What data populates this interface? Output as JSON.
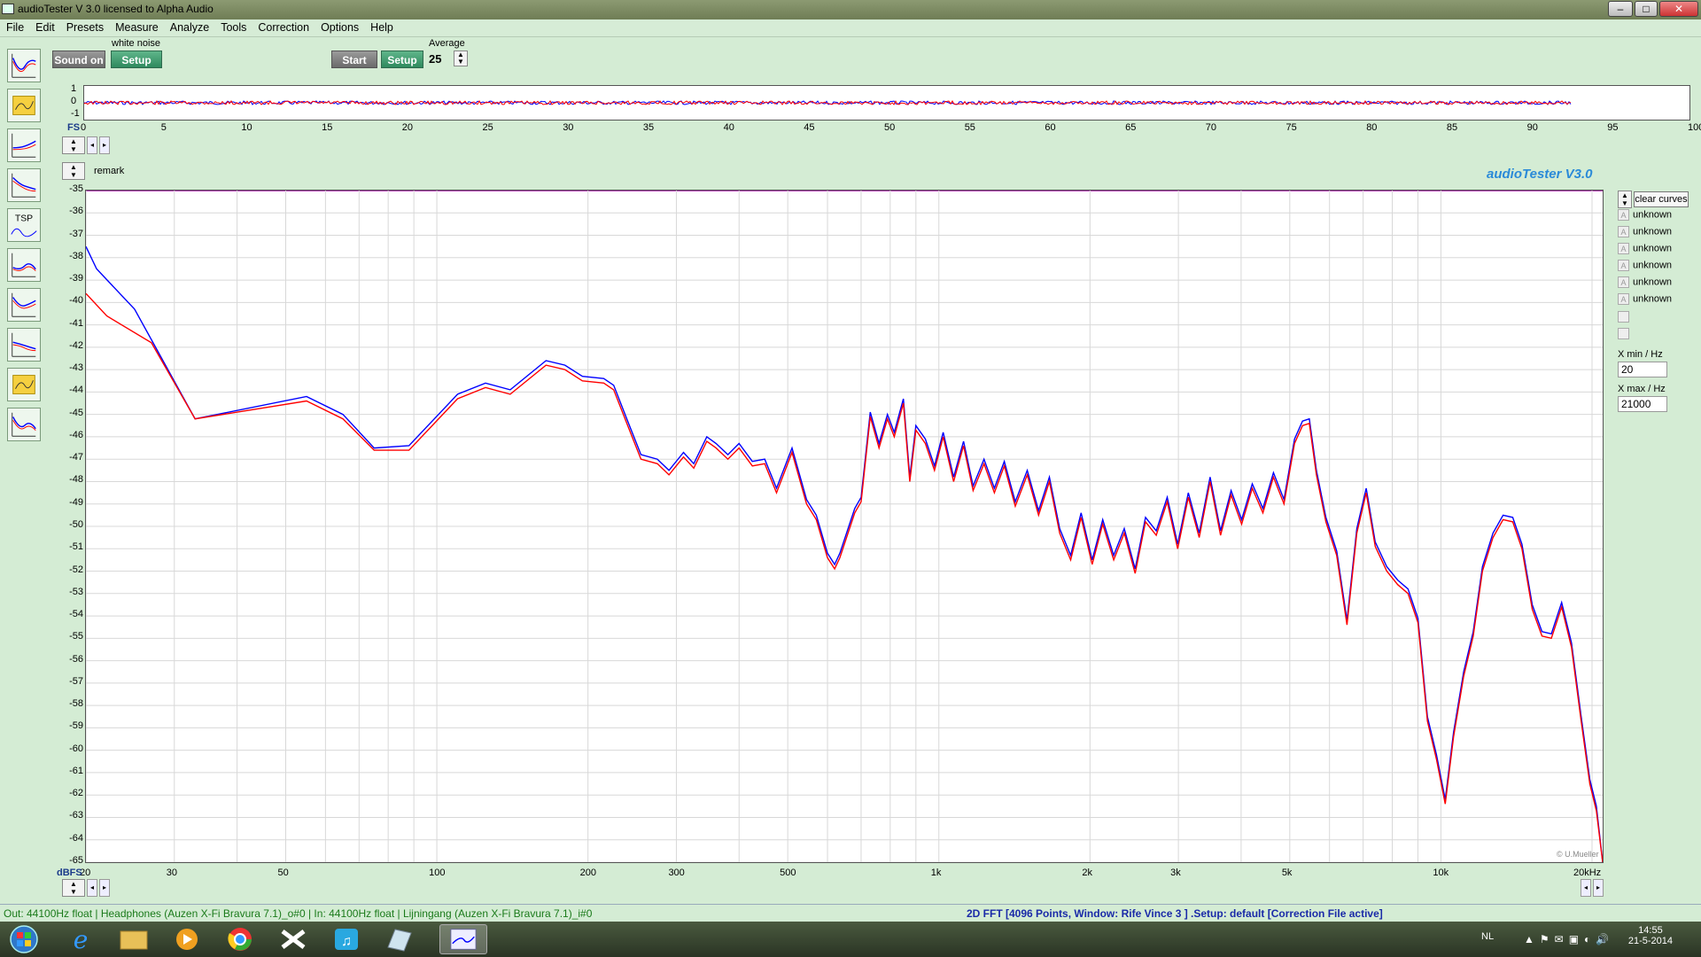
{
  "window": {
    "title": "audioTester  V 3.0   licensed to Alpha Audio"
  },
  "menu": [
    "File",
    "Edit",
    "Presets",
    "Measure",
    "Analyze",
    "Tools",
    "Correction",
    "Options",
    "Help"
  ],
  "toolbar": {
    "generator_label": "white noise",
    "sound_on": "Sound on",
    "setup1": "Setup",
    "start": "Start",
    "setup2": "Setup",
    "average_label": "Average",
    "average_value": "25"
  },
  "time_plot": {
    "y_ticks": [
      "1",
      "0",
      "-1"
    ],
    "x_prefix": "FS",
    "x_ticks": [
      "0",
      "5",
      "10",
      "15",
      "20",
      "25",
      "30",
      "35",
      "40",
      "45",
      "50",
      "55",
      "60",
      "65",
      "70",
      "75",
      "80",
      "85",
      "90",
      "95",
      "100ms"
    ]
  },
  "main": {
    "remark": "remark",
    "brand": "audioTester  V3.0",
    "copyright": "© U.Mueller",
    "y_unit": "dBFS",
    "y_ticks": [
      "-35",
      "-36",
      "-37",
      "-38",
      "-39",
      "-40",
      "-41",
      "-42",
      "-43",
      "-44",
      "-45",
      "-46",
      "-47",
      "-48",
      "-49",
      "-50",
      "-51",
      "-52",
      "-53",
      "-54",
      "-55",
      "-56",
      "-57",
      "-58",
      "-59",
      "-60",
      "-61",
      "-62",
      "-63",
      "-64",
      "-65"
    ],
    "x_ticks": [
      {
        "label": "20",
        "f": 20
      },
      {
        "label": "30",
        "f": 30
      },
      {
        "label": "50",
        "f": 50
      },
      {
        "label": "100",
        "f": 100
      },
      {
        "label": "200",
        "f": 200
      },
      {
        "label": "300",
        "f": 300
      },
      {
        "label": "500",
        "f": 500
      },
      {
        "label": "1k",
        "f": 1000
      },
      {
        "label": "2k",
        "f": 2000
      },
      {
        "label": "3k",
        "f": 3000
      },
      {
        "label": "5k",
        "f": 5000
      },
      {
        "label": "10k",
        "f": 10000
      },
      {
        "label": "20kHz",
        "f": 20000
      }
    ]
  },
  "chart_data": {
    "type": "line",
    "title": "",
    "xlabel": "",
    "ylabel": "dBFS",
    "xscale": "log",
    "xlim": [
      20,
      21000
    ],
    "ylim": [
      -65,
      -35
    ],
    "grid": true,
    "series": [
      {
        "color": "#0000ff",
        "points": [
          [
            20,
            -37.5
          ],
          [
            21,
            -38.5
          ],
          [
            25,
            -40.3
          ],
          [
            33,
            -45.2
          ],
          [
            55,
            -44.2
          ],
          [
            65,
            -45
          ],
          [
            75,
            -46.5
          ],
          [
            88,
            -46.4
          ],
          [
            110,
            -44.1
          ],
          [
            125,
            -43.6
          ],
          [
            140,
            -43.9
          ],
          [
            165,
            -42.6
          ],
          [
            180,
            -42.8
          ],
          [
            195,
            -43.3
          ],
          [
            215,
            -43.4
          ],
          [
            225,
            -43.7
          ],
          [
            240,
            -45.3
          ],
          [
            255,
            -46.8
          ],
          [
            275,
            -47
          ],
          [
            290,
            -47.5
          ],
          [
            310,
            -46.7
          ],
          [
            325,
            -47.2
          ],
          [
            345,
            -46
          ],
          [
            360,
            -46.3
          ],
          [
            380,
            -46.8
          ],
          [
            400,
            -46.3
          ],
          [
            425,
            -47.1
          ],
          [
            450,
            -47
          ],
          [
            475,
            -48.3
          ],
          [
            510,
            -46.5
          ],
          [
            545,
            -48.8
          ],
          [
            570,
            -49.5
          ],
          [
            600,
            -51.2
          ],
          [
            620,
            -51.7
          ],
          [
            635,
            -51.2
          ],
          [
            680,
            -49.2
          ],
          [
            700,
            -48.7
          ],
          [
            730,
            -44.9
          ],
          [
            760,
            -46.3
          ],
          [
            790,
            -45
          ],
          [
            815,
            -45.8
          ],
          [
            850,
            -44.3
          ],
          [
            875,
            -47.8
          ],
          [
            900,
            -45.5
          ],
          [
            940,
            -46.1
          ],
          [
            980,
            -47.3
          ],
          [
            1020,
            -45.8
          ],
          [
            1070,
            -47.8
          ],
          [
            1120,
            -46.2
          ],
          [
            1170,
            -48.2
          ],
          [
            1230,
            -47
          ],
          [
            1290,
            -48.3
          ],
          [
            1350,
            -47.1
          ],
          [
            1420,
            -48.9
          ],
          [
            1500,
            -47.5
          ],
          [
            1580,
            -49.3
          ],
          [
            1660,
            -47.8
          ],
          [
            1740,
            -50.1
          ],
          [
            1830,
            -51.3
          ],
          [
            1920,
            -49.4
          ],
          [
            2020,
            -51.5
          ],
          [
            2120,
            -49.7
          ],
          [
            2230,
            -51.3
          ],
          [
            2340,
            -50.1
          ],
          [
            2460,
            -51.9
          ],
          [
            2580,
            -49.6
          ],
          [
            2710,
            -50.2
          ],
          [
            2850,
            -48.7
          ],
          [
            2990,
            -50.8
          ],
          [
            3140,
            -48.5
          ],
          [
            3300,
            -50.3
          ],
          [
            3470,
            -47.8
          ],
          [
            3640,
            -50.2
          ],
          [
            3820,
            -48.4
          ],
          [
            4010,
            -49.7
          ],
          [
            4210,
            -48.1
          ],
          [
            4420,
            -49.2
          ],
          [
            4640,
            -47.6
          ],
          [
            4870,
            -48.8
          ],
          [
            5110,
            -46.1
          ],
          [
            5300,
            -45.3
          ],
          [
            5470,
            -45.2
          ],
          [
            5650,
            -47.5
          ],
          [
            5900,
            -49.6
          ],
          [
            6200,
            -51.1
          ],
          [
            6500,
            -54.2
          ],
          [
            6800,
            -50.1
          ],
          [
            7100,
            -48.3
          ],
          [
            7400,
            -50.7
          ],
          [
            7800,
            -51.8
          ],
          [
            8200,
            -52.4
          ],
          [
            8600,
            -52.8
          ],
          [
            9000,
            -54.1
          ],
          [
            9400,
            -58.5
          ],
          [
            9800,
            -60.2
          ],
          [
            10200,
            -62.2
          ],
          [
            10600,
            -59.2
          ],
          [
            11100,
            -56.5
          ],
          [
            11600,
            -54.7
          ],
          [
            12100,
            -51.8
          ],
          [
            12700,
            -50.3
          ],
          [
            13300,
            -49.5
          ],
          [
            13900,
            -49.6
          ],
          [
            14500,
            -50.8
          ],
          [
            15200,
            -53.5
          ],
          [
            15900,
            -54.7
          ],
          [
            16600,
            -54.8
          ],
          [
            17400,
            -53.4
          ],
          [
            18200,
            -55.2
          ],
          [
            19000,
            -58.4
          ],
          [
            19800,
            -61.3
          ],
          [
            20400,
            -62.5
          ],
          [
            21000,
            -65
          ]
        ]
      },
      {
        "color": "#ff0000",
        "points": [
          [
            20,
            -39.6
          ],
          [
            22,
            -40.6
          ],
          [
            27,
            -41.8
          ],
          [
            33,
            -45.2
          ],
          [
            55,
            -44.4
          ],
          [
            65,
            -45.2
          ],
          [
            75,
            -46.6
          ],
          [
            88,
            -46.6
          ],
          [
            110,
            -44.3
          ],
          [
            125,
            -43.8
          ],
          [
            140,
            -44.1
          ],
          [
            165,
            -42.8
          ],
          [
            180,
            -43
          ],
          [
            195,
            -43.5
          ],
          [
            215,
            -43.6
          ],
          [
            225,
            -43.9
          ],
          [
            240,
            -45.5
          ],
          [
            255,
            -47
          ],
          [
            275,
            -47.2
          ],
          [
            290,
            -47.7
          ],
          [
            310,
            -46.9
          ],
          [
            325,
            -47.4
          ],
          [
            345,
            -46.2
          ],
          [
            360,
            -46.5
          ],
          [
            380,
            -47
          ],
          [
            400,
            -46.5
          ],
          [
            425,
            -47.3
          ],
          [
            450,
            -47.2
          ],
          [
            475,
            -48.5
          ],
          [
            510,
            -46.7
          ],
          [
            545,
            -49
          ],
          [
            570,
            -49.7
          ],
          [
            600,
            -51.4
          ],
          [
            620,
            -51.9
          ],
          [
            635,
            -51.4
          ],
          [
            680,
            -49.4
          ],
          [
            700,
            -48.9
          ],
          [
            730,
            -45.1
          ],
          [
            760,
            -46.5
          ],
          [
            790,
            -45.2
          ],
          [
            815,
            -46
          ],
          [
            850,
            -44.5
          ],
          [
            875,
            -48
          ],
          [
            900,
            -45.7
          ],
          [
            940,
            -46.3
          ],
          [
            980,
            -47.5
          ],
          [
            1020,
            -46
          ],
          [
            1070,
            -48
          ],
          [
            1120,
            -46.4
          ],
          [
            1170,
            -48.4
          ],
          [
            1230,
            -47.2
          ],
          [
            1290,
            -48.5
          ],
          [
            1350,
            -47.3
          ],
          [
            1420,
            -49.1
          ],
          [
            1500,
            -47.7
          ],
          [
            1580,
            -49.5
          ],
          [
            1660,
            -48
          ],
          [
            1740,
            -50.3
          ],
          [
            1830,
            -51.5
          ],
          [
            1920,
            -49.6
          ],
          [
            2020,
            -51.7
          ],
          [
            2120,
            -49.9
          ],
          [
            2230,
            -51.5
          ],
          [
            2340,
            -50.3
          ],
          [
            2460,
            -52.1
          ],
          [
            2580,
            -49.8
          ],
          [
            2710,
            -50.4
          ],
          [
            2850,
            -48.9
          ],
          [
            2990,
            -51
          ],
          [
            3140,
            -48.7
          ],
          [
            3300,
            -50.5
          ],
          [
            3470,
            -48
          ],
          [
            3640,
            -50.4
          ],
          [
            3820,
            -48.6
          ],
          [
            4010,
            -49.9
          ],
          [
            4210,
            -48.3
          ],
          [
            4420,
            -49.4
          ],
          [
            4640,
            -47.8
          ],
          [
            4870,
            -49
          ],
          [
            5110,
            -46.3
          ],
          [
            5300,
            -45.5
          ],
          [
            5470,
            -45.4
          ],
          [
            5650,
            -47.7
          ],
          [
            5900,
            -49.8
          ],
          [
            6200,
            -51.3
          ],
          [
            6500,
            -54.4
          ],
          [
            6800,
            -50.3
          ],
          [
            7100,
            -48.5
          ],
          [
            7400,
            -50.9
          ],
          [
            7800,
            -52
          ],
          [
            8200,
            -52.6
          ],
          [
            8600,
            -53
          ],
          [
            9000,
            -54.3
          ],
          [
            9400,
            -58.7
          ],
          [
            9800,
            -60.4
          ],
          [
            10200,
            -62.4
          ],
          [
            10600,
            -59.4
          ],
          [
            11100,
            -56.7
          ],
          [
            11600,
            -54.9
          ],
          [
            12100,
            -52
          ],
          [
            12700,
            -50.5
          ],
          [
            13300,
            -49.7
          ],
          [
            13900,
            -49.8
          ],
          [
            14500,
            -51
          ],
          [
            15200,
            -53.7
          ],
          [
            15900,
            -54.9
          ],
          [
            16600,
            -55
          ],
          [
            17400,
            -53.6
          ],
          [
            18200,
            -55.4
          ],
          [
            19000,
            -58.6
          ],
          [
            19800,
            -61.5
          ],
          [
            20400,
            -62.7
          ],
          [
            21000,
            -65
          ]
        ]
      }
    ]
  },
  "legend": {
    "clear_curves": "clear curves",
    "items": [
      "unknown",
      "unknown",
      "unknown",
      "unknown",
      "unknown",
      "unknown"
    ],
    "box_letter": "A",
    "xmin_label": "X min / Hz",
    "xmin_value": "20",
    "xmax_label": "X max / Hz",
    "xmax_value": "21000"
  },
  "status": {
    "left": "Out: 44100Hz float  | Headphones (Auzen X-Fi Bravura 7.1)_o#0  | In: 44100Hz float  | Lijningang (Auzen X-Fi Bravura 7.1)_i#0",
    "center": "2D FFT [4096 Points, Window: Rife Vince 3 ]  .Setup:  default  [Correction File active]"
  },
  "taskbar": {
    "lang": "NL",
    "time": "14:55",
    "date": "21-5-2014"
  }
}
